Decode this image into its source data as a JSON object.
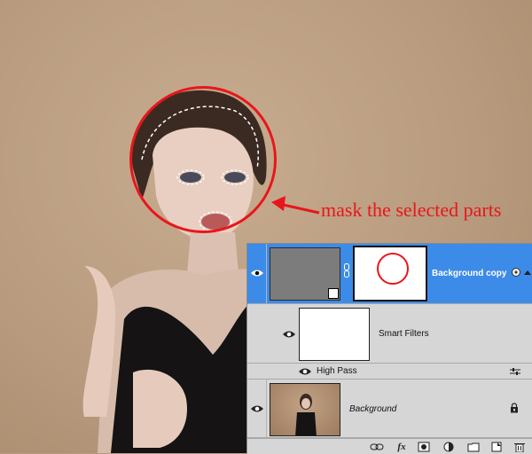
{
  "annotation": {
    "text": "mask the selected parts",
    "color": "#e8161c"
  },
  "layers_panel": {
    "layers": [
      {
        "name": "Background copy",
        "selected": true,
        "thumbnail": "gray-high-pass",
        "mask": "white-with-selection",
        "smart_object": true
      },
      {
        "name": "Smart Filters",
        "thumbnail": "white-filter-mask"
      },
      {
        "name": "High Pass",
        "kind": "smart-filter"
      },
      {
        "name": "Background",
        "italic": true,
        "locked": true,
        "thumbnail": "photo"
      }
    ],
    "footer_icons": [
      "link-icon",
      "fx-icon",
      "add-mask-icon",
      "adjustment-icon",
      "group-icon",
      "new-layer-icon",
      "trash-icon"
    ],
    "footer_labels": {
      "fx": "fx"
    },
    "selected_color": "#3d8be8"
  },
  "colors": {
    "wall": "#b99c7f",
    "panel": "#d6d6d6"
  }
}
